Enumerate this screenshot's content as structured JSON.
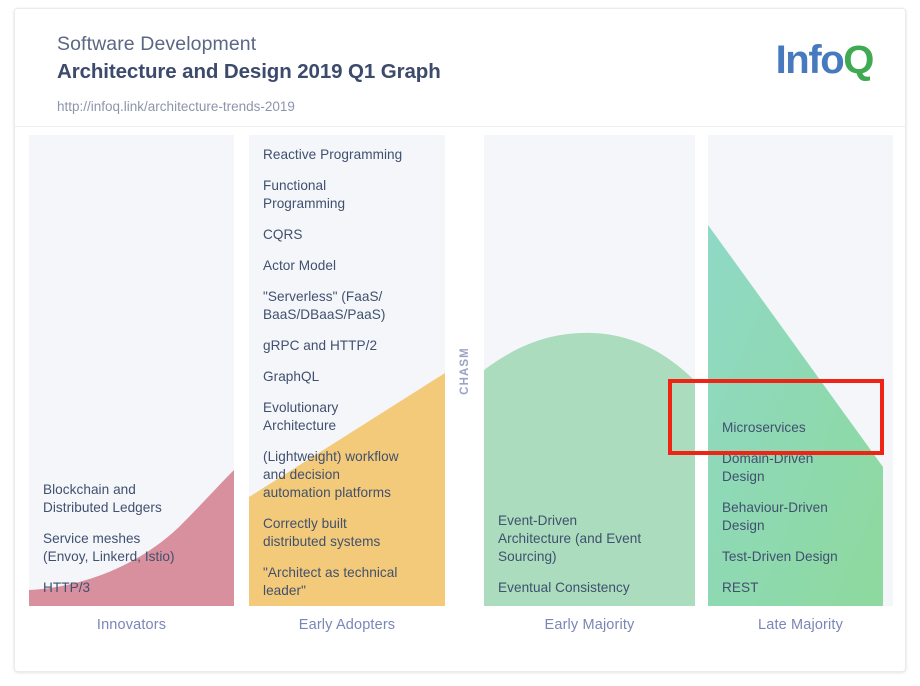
{
  "header": {
    "eyebrow": "Software Development",
    "title": "Architecture and Design 2019 Q1 Graph",
    "subtitle": "http://infoq.link/architecture-trends-2019",
    "logo_info": "Info",
    "logo_q": "Q"
  },
  "chasm_label": "CHASM",
  "colors": {
    "column_bg": "#f4f6fa",
    "innovators_curve": "#d9909e",
    "early_adopters_curve": "#f3ca79",
    "early_majority_curve": "#aadcbd",
    "late_majority_curve_start": "#8fd9c6",
    "late_majority_curve_end": "#8ed99f",
    "text": "#40506e",
    "label": "#7a86b6",
    "highlight": "#ee2417",
    "logo_info": "#4679bd",
    "logo_q": "#3faa52"
  },
  "chart_data": {
    "type": "table",
    "title": "Architecture and Design 2019 Q1 Graph",
    "columns": [
      "Innovators",
      "Early Adopters",
      "Early Majority",
      "Late Majority"
    ],
    "divider": "CHASM",
    "divider_after_column": "Early Adopters",
    "series": [
      {
        "name": "Innovators",
        "items": [
          "Blockchain and Distributed Ledgers",
          "Service meshes (Envoy, Linkerd, Istio)",
          "HTTP/3"
        ]
      },
      {
        "name": "Early Adopters",
        "items": [
          "Reactive Programming",
          "Functional Programming",
          "CQRS",
          "Actor Model",
          "\"Serverless\" (FaaS/BaaS/DBaaS/PaaS)",
          "gRPC and HTTP/2",
          "GraphQL",
          "Evolutionary Architecture",
          "(Lightweight) workflow and decision automation platforms",
          "Correctly built distributed systems",
          "\"Architect as technical leader\""
        ]
      },
      {
        "name": "Early Majority",
        "items": [
          "Event-Driven Architecture (and Event Sourcing)",
          "Eventual Consistency"
        ]
      },
      {
        "name": "Late Majority",
        "items": [
          "Microservices",
          "Domain-Driven Design",
          "Behaviour-Driven Design",
          "Test-Driven Design",
          "REST"
        ]
      }
    ],
    "annotations": [
      {
        "type": "highlight-rect",
        "target": "Microservices",
        "color": "#ee2417"
      }
    ]
  },
  "columns": {
    "col1": {
      "label": "Innovators",
      "items": [
        {
          "line1": "Blockchain and",
          "line2": "Distributed Ledgers"
        },
        {
          "line1": "Service meshes",
          "line2": "(Envoy, Linkerd, Istio)"
        },
        {
          "line1": "HTTP/3",
          "line2": ""
        }
      ]
    },
    "col2": {
      "label": "Early Adopters",
      "items": [
        {
          "line1": "Reactive Programming",
          "line2": ""
        },
        {
          "line1": "Functional",
          "line2": "Programming"
        },
        {
          "line1": "CQRS",
          "line2": ""
        },
        {
          "line1": "Actor Model",
          "line2": ""
        },
        {
          "line1": "\"Serverless\" (FaaS/",
          "line2": "BaaS/DBaaS/PaaS)"
        },
        {
          "line1": "gRPC and HTTP/2",
          "line2": ""
        },
        {
          "line1": "GraphQL",
          "line2": ""
        },
        {
          "line1": "Evolutionary",
          "line2": "Architecture"
        },
        {
          "line1": "(Lightweight) workflow",
          "line2": "and decision",
          "line3": "automation platforms"
        },
        {
          "line1": "Correctly built",
          "line2": "distributed systems"
        },
        {
          "line1": "\"Architect as technical",
          "line2": "leader\""
        }
      ]
    },
    "col3": {
      "label": "Early Majority",
      "items": [
        {
          "line1": "Event-Driven",
          "line2": "Architecture (and Event",
          "line3": "Sourcing)"
        },
        {
          "line1": "Eventual Consistency",
          "line2": ""
        }
      ]
    },
    "col4": {
      "label": "Late Majority",
      "items": [
        {
          "line1": "Microservices",
          "line2": ""
        },
        {
          "line1": "Domain-Driven",
          "line2": "Design"
        },
        {
          "line1": "Behaviour-Driven",
          "line2": "Design"
        },
        {
          "line1": "Test-Driven Design",
          "line2": ""
        },
        {
          "line1": "REST",
          "line2": ""
        }
      ]
    }
  }
}
